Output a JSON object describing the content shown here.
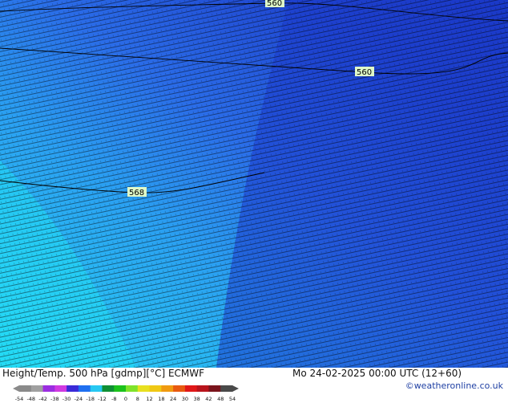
{
  "map": {
    "contour_labels": [
      "560",
      "560",
      "568"
    ],
    "background_colors": {
      "northeast": "#1a35c4",
      "central": "#2a78f0",
      "southwest": "#27d8f5"
    },
    "contour_color": "#000000"
  },
  "footer": {
    "title": "Height/Temp. 500 hPa [gdmp][°C] ECMWF",
    "valid_time": "Mo 24-02-2025 00:00 UTC (12+60)",
    "copyright": "©weatheronline.co.uk"
  },
  "color_scale": {
    "ticks": [
      "-54",
      "-48",
      "-42",
      "-38",
      "-30",
      "-24",
      "-18",
      "-12",
      "-8",
      "0",
      "8",
      "12",
      "18",
      "24",
      "30",
      "38",
      "42",
      "48",
      "54"
    ],
    "colors": [
      "#8a8a8a",
      "#a0a0a0",
      "#9b2de0",
      "#d03ae0",
      "#3a2ad8",
      "#1f6ff0",
      "#27c8f2",
      "#0f8f34",
      "#1cc21c",
      "#7fe32a",
      "#e8e020",
      "#f0c814",
      "#f09a10",
      "#e85a10",
      "#e01818",
      "#b8141c",
      "#7a141c",
      "#4a4a4a"
    ]
  }
}
